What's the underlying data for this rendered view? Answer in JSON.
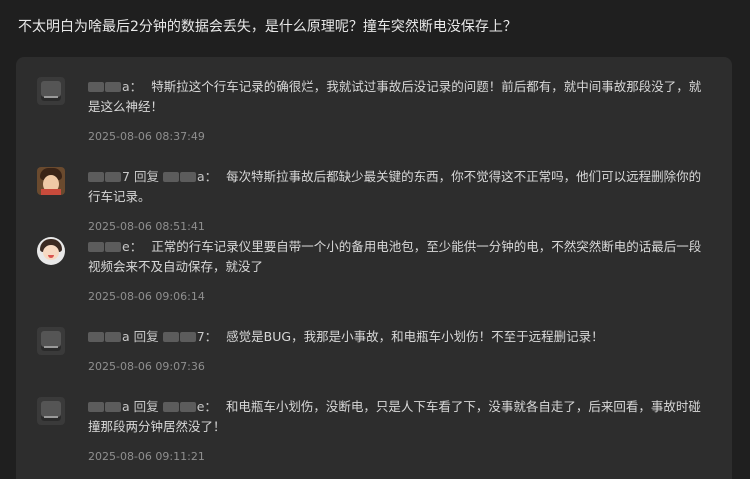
{
  "question": {
    "title": "不太明白为啥最后2分钟的数据会丢失，是什么原理呢？撞车突然断电没保存上？"
  },
  "comments": [
    {
      "avatar": "logo-avatar",
      "user": "a",
      "reply_word": "",
      "reply_to": "",
      "text": "特斯拉这个行车记录的确很烂，我就试过事故后没记录的问题！前后都有，就中间事故那段没了，就是这么神经！",
      "time": "2025-08-06 08:37:49"
    },
    {
      "avatar": "child-photo-avatar",
      "user": "7",
      "reply_word": "回复",
      "reply_to": "a",
      "text": "每次特斯拉事故后都缺少最关键的东西，你不觉得这不正常吗，他们可以远程删除你的行车记录。",
      "time": "2025-08-06 08:51:41"
    },
    {
      "avatar": "cartoon-avatar",
      "user": "e",
      "reply_word": "",
      "reply_to": "",
      "text": "正常的行车记录仪里要自带一个小的备用电池包，至少能供一分钟的电，不然突然断电的话最后一段视频会来不及自动保存，就没了",
      "time": "2025-08-06 09:06:14"
    },
    {
      "avatar": "logo-avatar",
      "user": "a",
      "reply_word": "回复",
      "reply_to": "7",
      "text": "感觉是BUG，我那是小事故，和电瓶车小划伤！不至于远程删记录！",
      "time": "2025-08-06 09:07:36"
    },
    {
      "avatar": "logo-avatar",
      "user": "a",
      "reply_word": "回复",
      "reply_to": "e",
      "text": "和电瓶车小划伤，没断电，只是人下车看了下，没事就各自走了，后来回看，事故时碰撞那段两分钟居然没了！",
      "time": "2025-08-06 09:11:21"
    }
  ]
}
